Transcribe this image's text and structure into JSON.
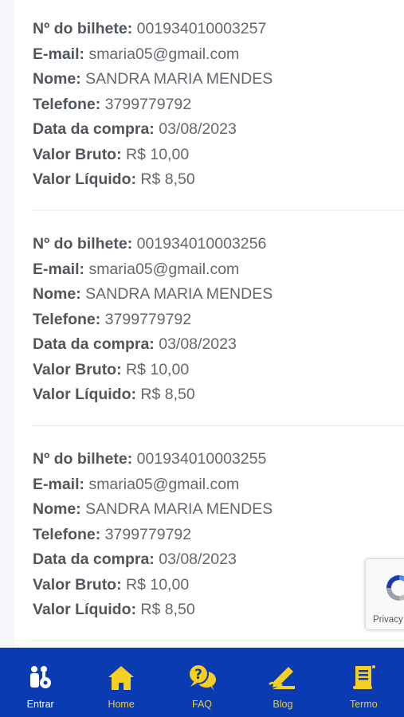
{
  "tickets": [
    {
      "ticket_label": "Nº do bilhete:",
      "ticket_number": "001934010003257",
      "email_label": "E-mail:",
      "email": "smaria05@gmail.com",
      "name_label": "Nome:",
      "name": "SANDRA MARIA MENDES",
      "phone_label": "Telefone:",
      "phone": "3799779792",
      "date_label": "Data da compra:",
      "date": "03/08/2023",
      "gross_label": "Valor Bruto:",
      "gross": "R$ 10,00",
      "net_label": "Valor Líquido:",
      "net": "R$ 8,50"
    },
    {
      "ticket_label": "Nº do bilhete:",
      "ticket_number": "001934010003256",
      "email_label": "E-mail:",
      "email": "smaria05@gmail.com",
      "name_label": "Nome:",
      "name": "SANDRA MARIA MENDES",
      "phone_label": "Telefone:",
      "phone": "3799779792",
      "date_label": "Data da compra:",
      "date": "03/08/2023",
      "gross_label": "Valor Bruto:",
      "gross": "R$ 10,00",
      "net_label": "Valor Líquido:",
      "net": "R$ 8,50"
    },
    {
      "ticket_label": "Nº do bilhete:",
      "ticket_number": "001934010003255",
      "email_label": "E-mail:",
      "email": "smaria05@gmail.com",
      "name_label": "Nome:",
      "name": "SANDRA MARIA MENDES",
      "phone_label": "Telefone:",
      "phone": "3799779792",
      "date_label": "Data da compra:",
      "date": "03/08/2023",
      "gross_label": "Valor Bruto:",
      "gross": "R$ 10,00",
      "net_label": "Valor Líquido:",
      "net": "R$ 8,50"
    }
  ],
  "recaptcha": {
    "privacy_label": "Privacy",
    "icon": "recaptcha-logo"
  },
  "nav": {
    "active": "Entrar",
    "items": [
      {
        "label": "Entrar",
        "icon": "user-key-icon"
      },
      {
        "label": "Home",
        "icon": "home-icon"
      },
      {
        "label": "FAQ",
        "icon": "question-chat-icon"
      },
      {
        "label": "Blog",
        "icon": "pencil-write-icon"
      },
      {
        "label": "Termo",
        "icon": "document-icon"
      }
    ]
  },
  "colors": {
    "nav_background": "#0a3bb0",
    "nav_icon_accent": "#f6cf21",
    "nav_active_label": "#ffffff"
  }
}
